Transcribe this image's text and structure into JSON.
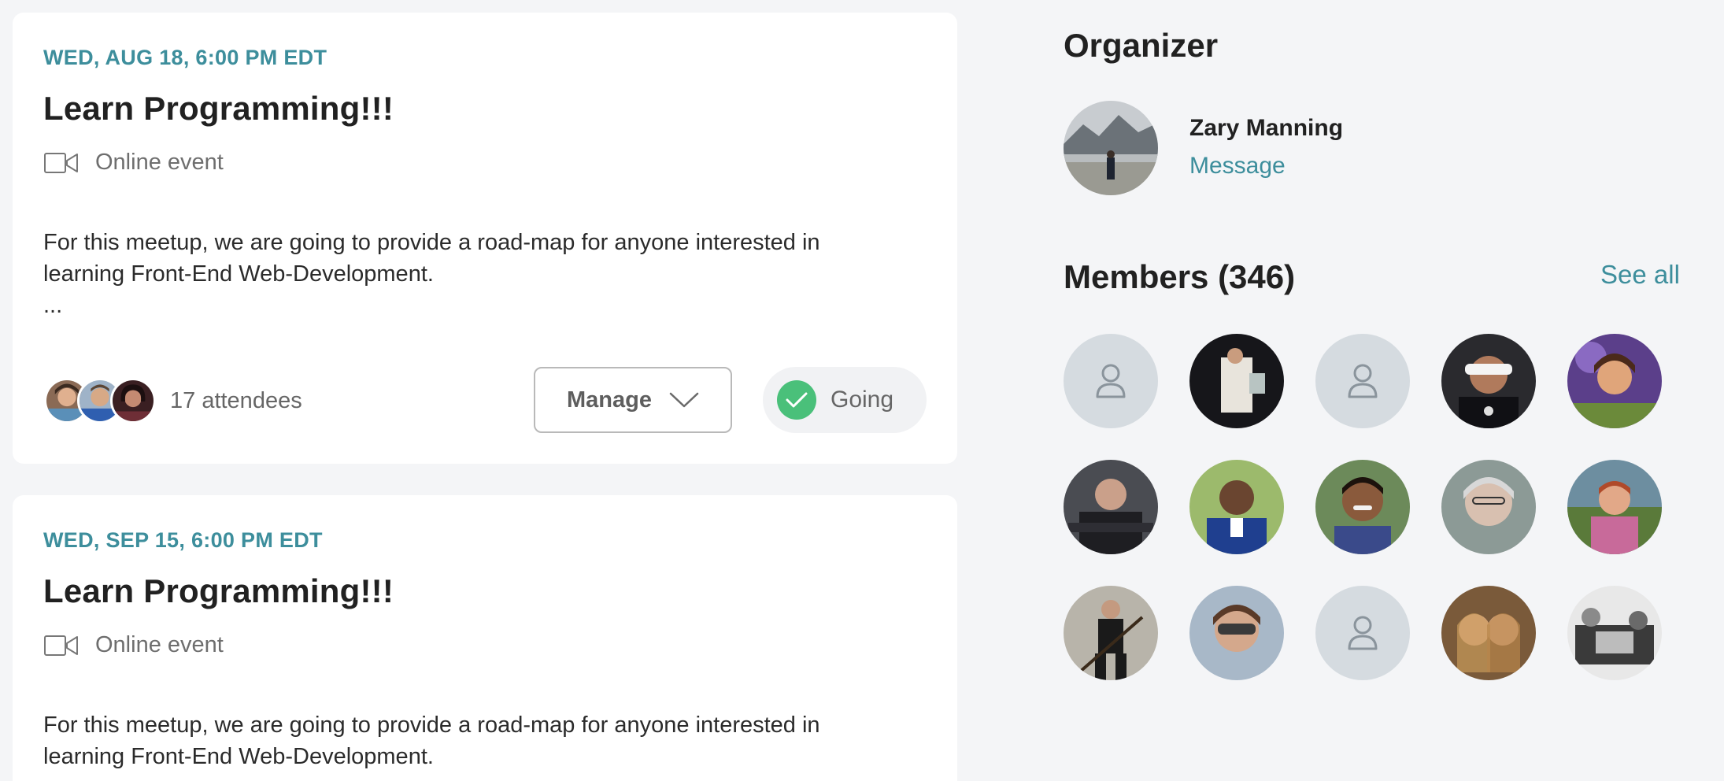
{
  "events": [
    {
      "date": "WED, AUG 18, 6:00 PM EDT",
      "title": "Learn Programming!!!",
      "location": "Online event",
      "location_icon": "video-camera-icon",
      "description": "For this meetup, we are going to provide a road-map for anyone interested in learning Front-End Web-Development.",
      "ellipsis": "...",
      "attendees_label": "17 attendees",
      "manage_label": "Manage",
      "going_label": "Going"
    },
    {
      "date": "WED, SEP 15, 6:00 PM EDT",
      "title": "Learn Programming!!!",
      "location": "Online event",
      "location_icon": "video-camera-icon",
      "description": "For this meetup, we are going to provide a road-map for anyone interested in learning Front-End Web-Development."
    }
  ],
  "organizer": {
    "heading": "Organizer",
    "name": "Zary Manning",
    "message_label": "Message"
  },
  "members": {
    "heading": "Members (346)",
    "see_all_label": "See all"
  },
  "colors": {
    "accent": "#3d8e9c",
    "going_check": "#4ac07a",
    "background": "#f4f5f7",
    "placeholder_avatar": "#d5dbe0"
  }
}
